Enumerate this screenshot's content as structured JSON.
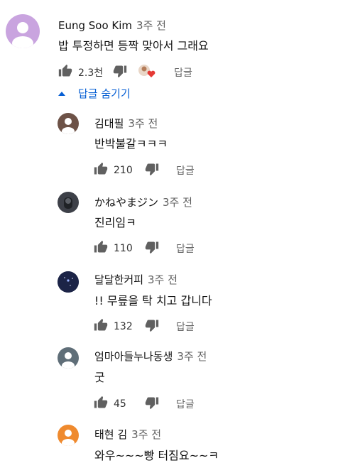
{
  "top": {
    "author": "Eung Soo Kim",
    "time": "3주 전",
    "text": "밥 투정하면 등짝 맞아서 그래요",
    "likes": "2.3천",
    "reply": "답글"
  },
  "hide_replies": "답글 숨기기",
  "replies": [
    {
      "author": "김대필",
      "time": "3주 전",
      "text": "반박불갈ㅋㅋㅋ",
      "likes": "210",
      "reply": "답글"
    },
    {
      "author": "かねやまジン",
      "time": "3주 전",
      "text": "진리임ㅋ",
      "likes": "110",
      "reply": "답글"
    },
    {
      "author": "달달한커피",
      "time": "3주 전",
      "text": "!! 무릎을 탁 치고 갑니다",
      "likes": "132",
      "reply": "답글"
    },
    {
      "author": "엄마아들누나동생",
      "time": "3주 전",
      "text": "굿",
      "likes": "45",
      "reply": "답글"
    },
    {
      "author": "태현 김",
      "time": "3주 전",
      "text": "와우~~~빵 터짐요~~ㅋ",
      "likes": "",
      "reply": ""
    }
  ]
}
